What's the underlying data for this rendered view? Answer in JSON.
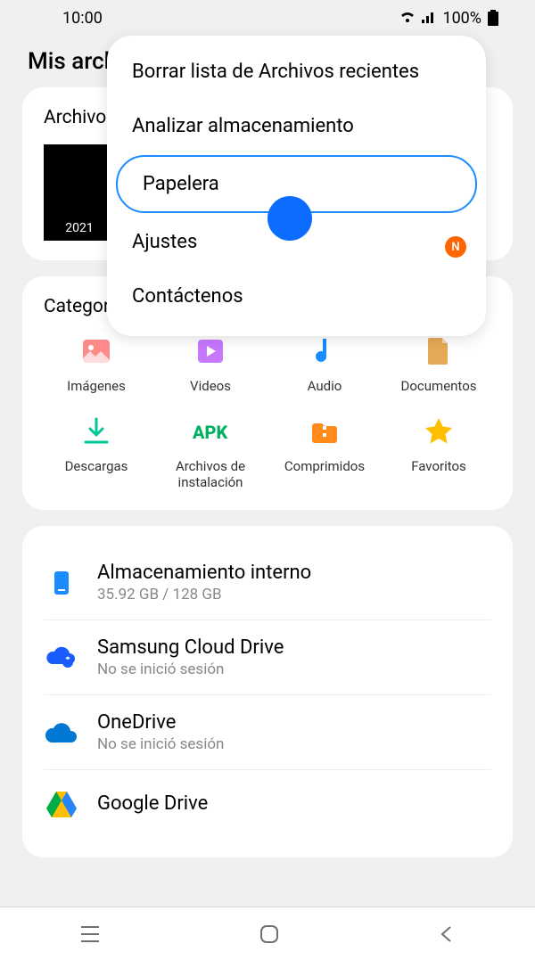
{
  "status": {
    "time": "10:00",
    "battery": "100%"
  },
  "app_title": "Mis archivos",
  "recent": {
    "title": "Archivos recientes",
    "year": "2021"
  },
  "categories": {
    "title": "Categorías",
    "items": [
      {
        "label": "Imágenes",
        "icon": "images"
      },
      {
        "label": "Videos",
        "icon": "videos"
      },
      {
        "label": "Audio",
        "icon": "audio"
      },
      {
        "label": "Documentos",
        "icon": "documents"
      },
      {
        "label": "Descargas",
        "icon": "downloads"
      },
      {
        "label": "Archivos de instalación",
        "icon": "apk"
      },
      {
        "label": "Comprimidos",
        "icon": "compressed"
      },
      {
        "label": "Favoritos",
        "icon": "favorites"
      }
    ]
  },
  "storage": [
    {
      "title": "Almacenamiento interno",
      "sub": "35.92 GB / 128 GB",
      "icon": "internal"
    },
    {
      "title": "Samsung Cloud Drive",
      "sub": "No se inició sesión",
      "icon": "samsung-cloud"
    },
    {
      "title": "OneDrive",
      "sub": "No se inició sesión",
      "icon": "onedrive"
    },
    {
      "title": "Google Drive",
      "sub": "",
      "icon": "google-drive"
    }
  ],
  "popup": {
    "items": [
      {
        "label": "Borrar lista de Archivos recientes",
        "highlight": false,
        "badge": false
      },
      {
        "label": "Analizar almacenamiento",
        "highlight": false,
        "badge": false
      },
      {
        "label": "Papelera",
        "highlight": true,
        "badge": false
      },
      {
        "label": "Ajustes",
        "highlight": false,
        "badge": true
      },
      {
        "label": "Contáctenos",
        "highlight": false,
        "badge": false
      }
    ],
    "badge_letter": "N"
  },
  "colors": {
    "highlight": "#1a8cff",
    "touch": "#0b6cff",
    "badge": "#ff6600"
  }
}
